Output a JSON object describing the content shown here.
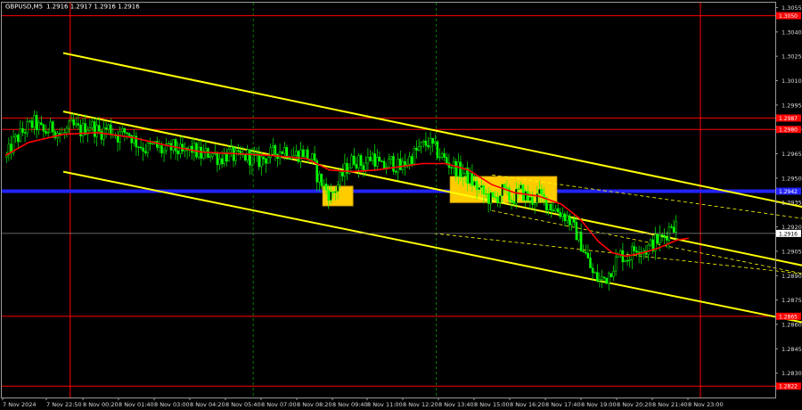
{
  "header": {
    "symbol": "GBPUSD,M5",
    "ohlc": "1.2916 1.2917 1.2916 1.2916"
  },
  "colors": {
    "background": "#000000",
    "candles": "#00ff00",
    "moving_average": "#ff0000",
    "channel_lines": "#ffff00",
    "support_resistance": "#ff0000",
    "blue_level": "#2323ff",
    "signal_box": "#ffcc00",
    "time_marker": "#ff0000",
    "session_marker": "#008000",
    "axis_text": "#dcdcdc"
  },
  "chart_data": {
    "type": "candlestick",
    "ylim": [
      1.2815,
      1.3058
    ],
    "y_ticks": [
      "1.3055",
      "1.3040",
      "1.3025",
      "1.3010",
      "1.2995",
      "1.2980",
      "1.2965",
      "1.2950",
      "1.2935",
      "1.2920",
      "1.2905",
      "1.2890",
      "1.2875",
      "1.2860",
      "1.2845",
      "1.2830"
    ],
    "x_ticks": [
      "7 Nov 2024",
      "7 Nov 22:50",
      "8 Nov 00:20",
      "8 Nov 01:40",
      "8 Nov 03:00",
      "8 Nov 04:20",
      "8 Nov 05:40",
      "8 Nov 07:00",
      "8 Nov 08:20",
      "8 Nov 09:40",
      "8 Nov 11:00",
      "8 Nov 12:20",
      "8 Nov 13:40",
      "8 Nov 15:00",
      "8 Nov 16:20",
      "8 Nov 17:40",
      "8 Nov 19:00",
      "8 Nov 20:20",
      "8 Nov 21:40",
      "8 Nov 23:00"
    ],
    "n_bars": 290,
    "price_path": [
      [
        0,
        1.2963
      ],
      [
        3,
        1.2972
      ],
      [
        8,
        1.298
      ],
      [
        12,
        1.2984
      ],
      [
        16,
        1.2978
      ],
      [
        20,
        1.2981
      ],
      [
        24,
        1.2976
      ],
      [
        28,
        1.2982
      ],
      [
        32,
        1.2979
      ],
      [
        36,
        1.2983
      ],
      [
        40,
        1.2978
      ],
      [
        44,
        1.2981
      ],
      [
        48,
        1.2976
      ],
      [
        52,
        1.2979
      ],
      [
        56,
        1.2972
      ],
      [
        60,
        1.2968
      ],
      [
        64,
        1.297
      ],
      [
        68,
        1.2966
      ],
      [
        72,
        1.2969
      ],
      [
        76,
        1.2965
      ],
      [
        80,
        1.2968
      ],
      [
        84,
        1.2964
      ],
      [
        88,
        1.2966
      ],
      [
        92,
        1.2962
      ],
      [
        96,
        1.2965
      ],
      [
        100,
        1.2962
      ],
      [
        104,
        1.2964
      ],
      [
        108,
        1.296
      ],
      [
        112,
        1.2963
      ],
      [
        116,
        1.2966
      ],
      [
        120,
        1.2968
      ],
      [
        124,
        1.2964
      ],
      [
        128,
        1.2966
      ],
      [
        132,
        1.2961
      ],
      [
        134,
        1.2952
      ],
      [
        137,
        1.2945
      ],
      [
        140,
        1.2939
      ],
      [
        143,
        1.2946
      ],
      [
        146,
        1.2955
      ],
      [
        150,
        1.2962
      ],
      [
        154,
        1.2958
      ],
      [
        158,
        1.2964
      ],
      [
        162,
        1.2956
      ],
      [
        166,
        1.296
      ],
      [
        170,
        1.2956
      ],
      [
        174,
        1.2962
      ],
      [
        178,
        1.2968
      ],
      [
        182,
        1.2972
      ],
      [
        186,
        1.2966
      ],
      [
        190,
        1.296
      ],
      [
        194,
        1.2956
      ],
      [
        198,
        1.2952
      ],
      [
        202,
        1.2946
      ],
      [
        206,
        1.294
      ],
      [
        210,
        1.2936
      ],
      [
        214,
        1.2942
      ],
      [
        218,
        1.2937
      ],
      [
        222,
        1.2942
      ],
      [
        226,
        1.2936
      ],
      [
        230,
        1.2939
      ],
      [
        234,
        1.2934
      ],
      [
        238,
        1.293
      ],
      [
        242,
        1.2926
      ],
      [
        246,
        1.2916
      ],
      [
        250,
        1.2903
      ],
      [
        253,
        1.2891
      ],
      [
        256,
        1.2887
      ],
      [
        259,
        1.2889
      ],
      [
        262,
        1.2897
      ],
      [
        265,
        1.2903
      ],
      [
        268,
        1.2901
      ],
      [
        272,
        1.2908
      ],
      [
        276,
        1.2906
      ],
      [
        280,
        1.2911
      ],
      [
        284,
        1.2914
      ],
      [
        287,
        1.2922
      ],
      [
        290,
        1.292
      ],
      [
        293,
        1.2917
      ],
      [
        295,
        1.2916
      ]
    ],
    "moving_average": [
      [
        0,
        1.2964
      ],
      [
        10,
        1.2972
      ],
      [
        25,
        1.2977
      ],
      [
        40,
        1.2978
      ],
      [
        55,
        1.2975
      ],
      [
        70,
        1.297
      ],
      [
        85,
        1.2966
      ],
      [
        100,
        1.2965
      ],
      [
        115,
        1.2964
      ],
      [
        130,
        1.2962
      ],
      [
        140,
        1.2955
      ],
      [
        150,
        1.2954
      ],
      [
        160,
        1.2955
      ],
      [
        170,
        1.2957
      ],
      [
        180,
        1.2959
      ],
      [
        190,
        1.2959
      ],
      [
        200,
        1.2955
      ],
      [
        210,
        1.2946
      ],
      [
        220,
        1.2941
      ],
      [
        230,
        1.2939
      ],
      [
        240,
        1.2934
      ],
      [
        248,
        1.2925
      ],
      [
        256,
        1.2911
      ],
      [
        262,
        1.2904
      ],
      [
        268,
        1.2902
      ],
      [
        275,
        1.2904
      ],
      [
        282,
        1.2907
      ],
      [
        290,
        1.2912
      ],
      [
        295,
        1.2913
      ]
    ],
    "channel_lines": [
      {
        "x": [
          25,
          345
        ],
        "y": [
          1.3027,
          1.2932
        ]
      },
      {
        "x": [
          25,
          345
        ],
        "y": [
          1.2991,
          1.2896
        ]
      },
      {
        "x": [
          25,
          345
        ],
        "y": [
          1.2954,
          1.2861
        ]
      }
    ],
    "dashed_channel": [
      {
        "x": [
          210,
          345
        ],
        "y": [
          1.2952,
          1.2925
        ]
      },
      {
        "x": [
          210,
          345
        ],
        "y": [
          1.293,
          1.2891
        ]
      },
      {
        "x": [
          185,
          345
        ],
        "y": [
          1.2916,
          1.2891
        ]
      }
    ],
    "levels": [
      {
        "label": "1.3050",
        "value": 1.305,
        "color": "#ff0000"
      },
      {
        "label": "1.2987",
        "value": 1.2987,
        "color": "#ff0000"
      },
      {
        "label": "1.2980",
        "value": 1.298,
        "color": "#ff0000"
      },
      {
        "label": "1.2942",
        "value": 1.2942,
        "color": "#2323ff"
      },
      {
        "label": "1.2865",
        "value": 1.2865,
        "color": "#ff0000"
      },
      {
        "label": "1.2822",
        "value": 1.2822,
        "color": "#ff0000"
      }
    ],
    "current_price": {
      "label": "1.2916",
      "value": 1.2916
    },
    "signal_boxes": [
      {
        "x": [
          137,
          150
        ],
        "y": [
          1.2933,
          1.2945
        ]
      },
      {
        "x": [
          192,
          238
        ],
        "y": [
          1.2935,
          1.2951
        ]
      }
    ],
    "vertical_markers": [
      {
        "bar": 28,
        "type": "red"
      },
      {
        "bar": 107,
        "type": "green-dashed"
      },
      {
        "bar": 186,
        "type": "green-dashed"
      },
      {
        "bar": 300,
        "type": "red"
      }
    ]
  }
}
